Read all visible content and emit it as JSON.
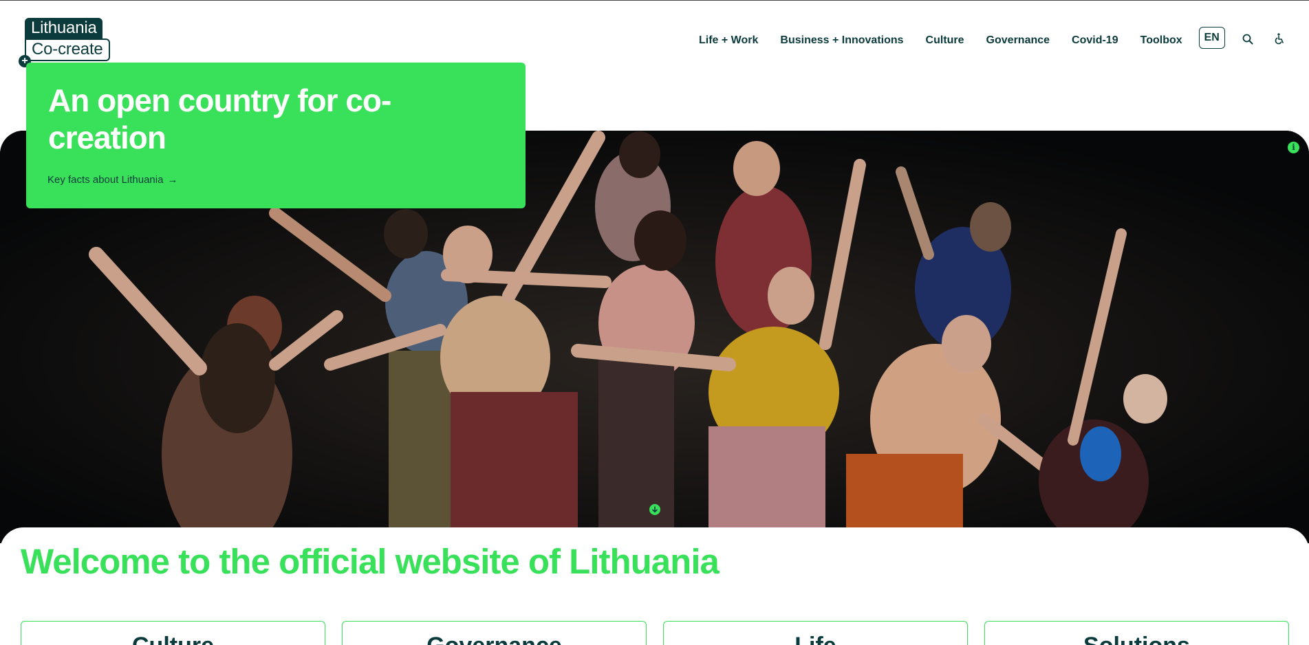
{
  "logo": {
    "line1": "Lithuania",
    "line2": "Co-create",
    "plus": "+"
  },
  "nav": {
    "items": [
      "Life + Work",
      "Business + Innovations",
      "Culture",
      "Governance",
      "Covid-19",
      "Toolbox"
    ],
    "language": "EN",
    "search_icon": "search-icon",
    "accessibility_icon": "accessibility-icon"
  },
  "hero": {
    "title": "An open country for co-creation",
    "link_label": "Key facts about Lithuania",
    "link_arrow": "→",
    "info_icon": "i",
    "image_alt": "dancers-photo"
  },
  "welcome": {
    "title": "Welcome to the official website of Lithuania",
    "cards": [
      "Culture",
      "Governance",
      "Life",
      "Solutions"
    ]
  },
  "colors": {
    "accent": "#39e05a",
    "brand_dark": "#0b3b3c",
    "hero_bg": "#060708"
  }
}
